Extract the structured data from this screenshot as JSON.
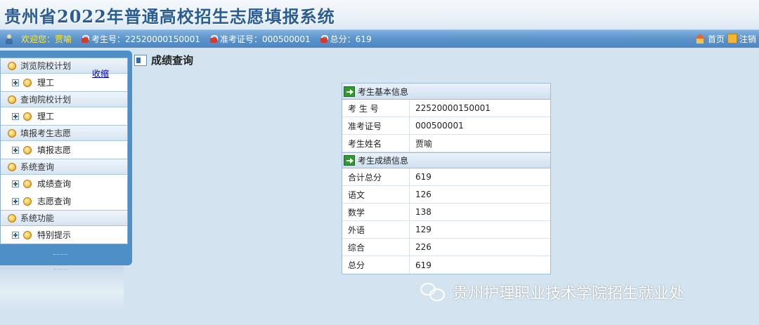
{
  "header": {
    "title": "贵州省2022年普通高校招生志愿填报系统"
  },
  "status_bar": {
    "welcome_label": "欢迎您：",
    "user_name": "贾喻",
    "exam_no_label": "考生号：",
    "exam_no": "22520000150001",
    "ticket_no_label": "准考证号：",
    "ticket_no": "000500001",
    "total_label": "总分：",
    "total": "619",
    "home_link": "首页",
    "logout_link": "注销"
  },
  "sidebar": {
    "collapse_link": "收缩",
    "groups": [
      {
        "label": "浏览院校计划",
        "items": [
          {
            "label": "理工"
          }
        ]
      },
      {
        "label": "查询院校计划",
        "items": [
          {
            "label": "理工"
          }
        ]
      },
      {
        "label": "填报考生志愿",
        "items": [
          {
            "label": "填报志愿"
          }
        ]
      },
      {
        "label": "系统查询",
        "items": [
          {
            "label": "成绩查询"
          },
          {
            "label": "志愿查询"
          }
        ]
      },
      {
        "label": "系统功能",
        "items": [
          {
            "label": "特别提示"
          }
        ]
      }
    ]
  },
  "main": {
    "page_title": "成绩查询",
    "basic_section": {
      "title": "考生基本信息",
      "rows": [
        {
          "key": "考 生 号",
          "value": "22520000150001"
        },
        {
          "key": "准考证号",
          "value": "000500001"
        },
        {
          "key": "考生姓名",
          "value": "贾喻"
        }
      ]
    },
    "score_section": {
      "title": "考生成绩信息",
      "rows": [
        {
          "key": "合计总分",
          "value": "619"
        },
        {
          "key": "语文",
          "value": "126"
        },
        {
          "key": "数学",
          "value": "138"
        },
        {
          "key": "外语",
          "value": "129"
        },
        {
          "key": "综合",
          "value": "226"
        },
        {
          "key": "总分",
          "value": "619"
        }
      ]
    }
  },
  "watermark": {
    "text": "贵州护理职业技术学院招生就业处",
    "icon": "wechat-icon"
  },
  "colors": {
    "status_bar": "#5b93cb",
    "title_text": "#2b5d95",
    "panel": "#4f8fc8",
    "background": "#d4e3f0"
  }
}
